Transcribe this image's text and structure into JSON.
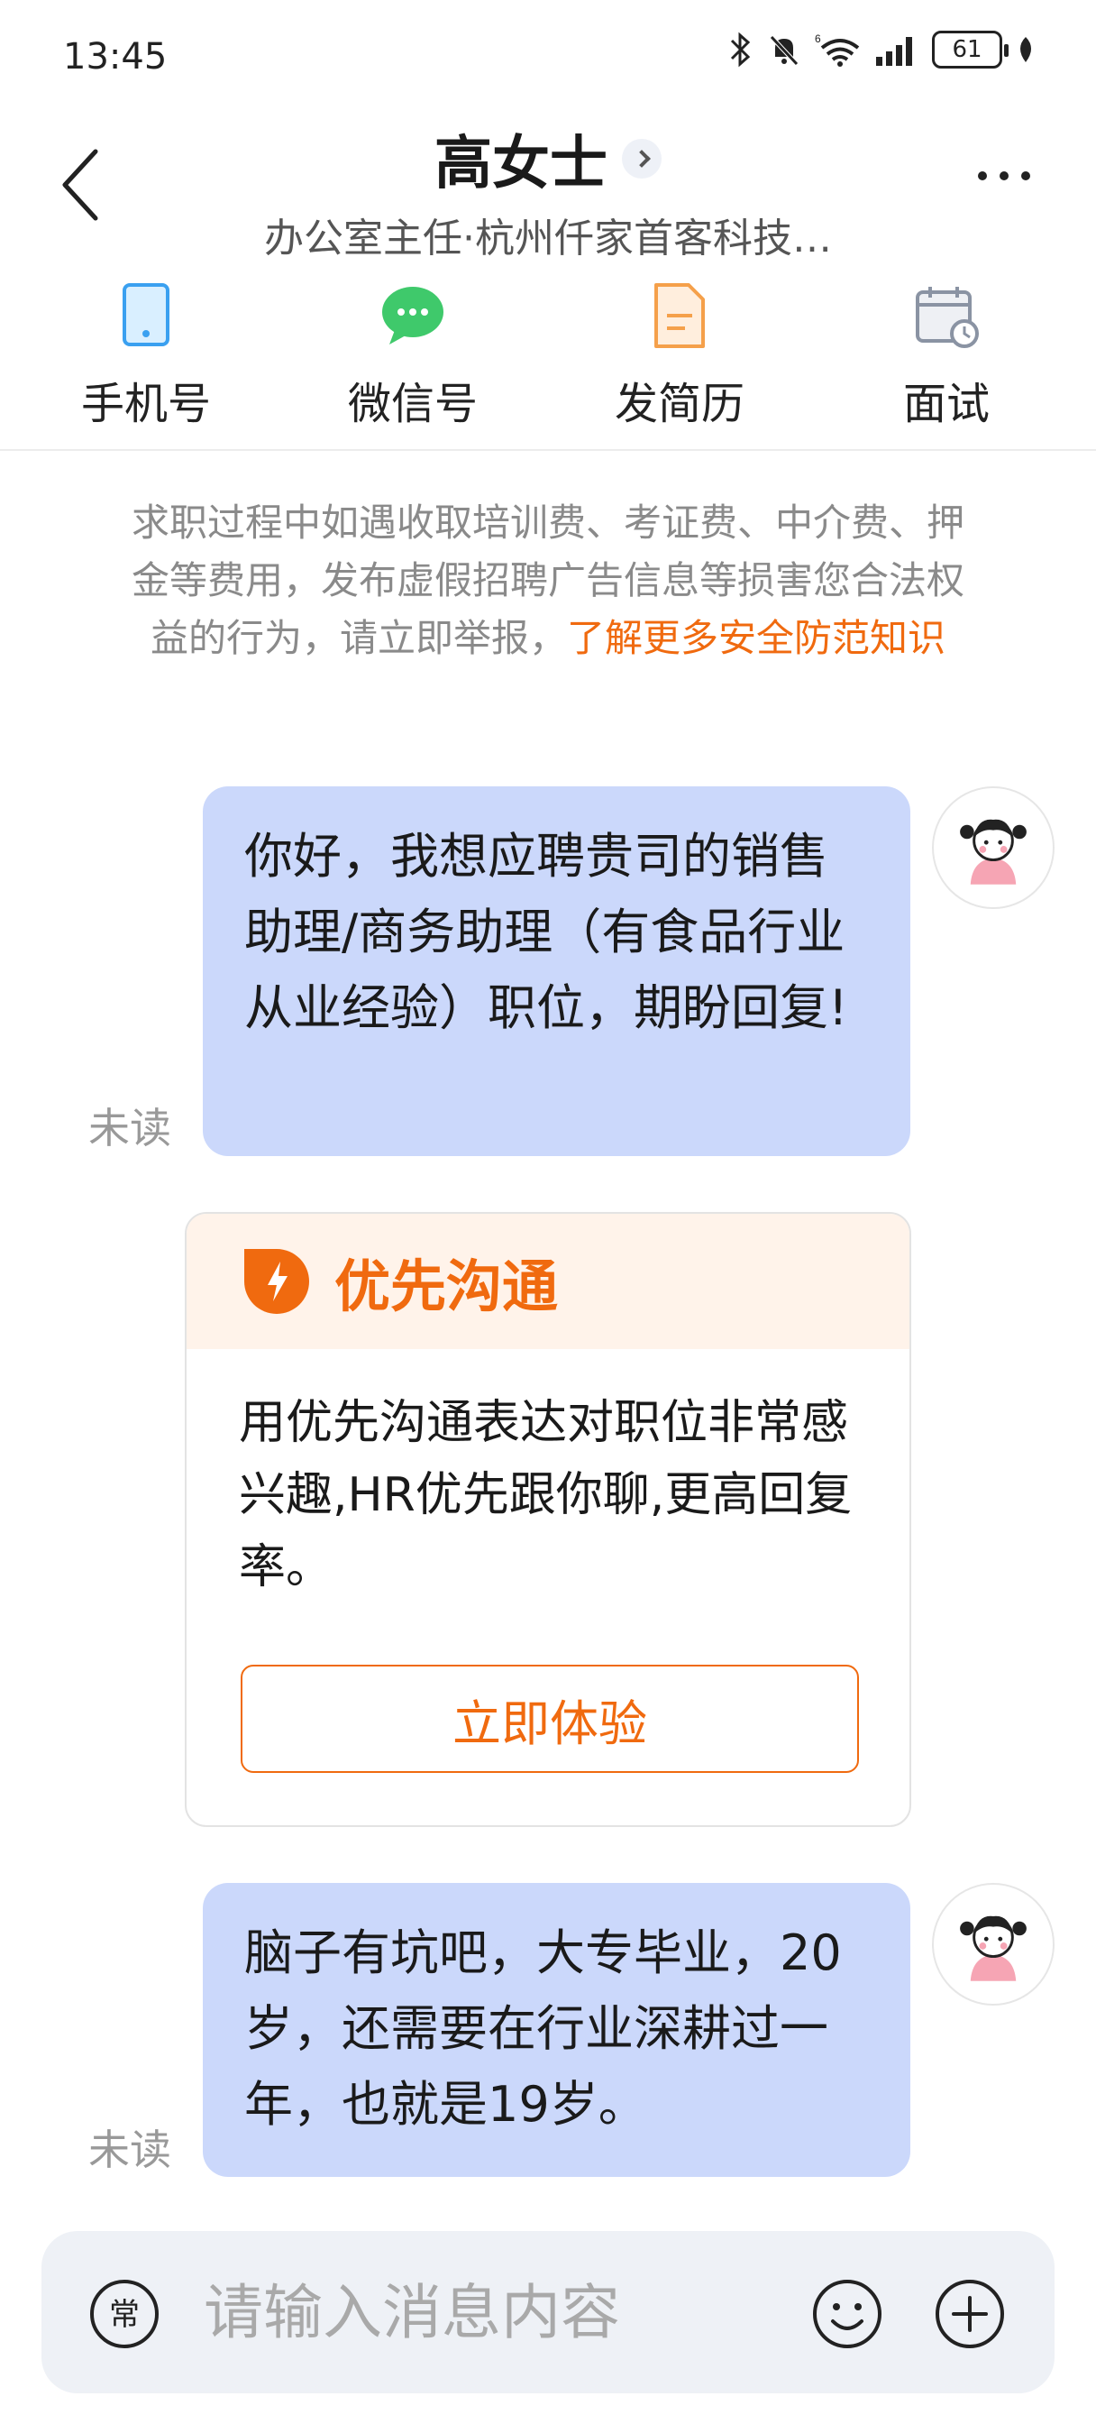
{
  "status_bar": {
    "time": "13:45",
    "battery": "61",
    "signal_label": "6"
  },
  "header": {
    "name": "高女士",
    "subtitle": "办公室主任·杭州仟家首客科技…"
  },
  "actions": [
    {
      "label": "手机号",
      "icon": "phone-icon"
    },
    {
      "label": "微信号",
      "icon": "wechat-icon"
    },
    {
      "label": "发简历",
      "icon": "resume-icon"
    },
    {
      "label": "面试",
      "icon": "interview-calendar-icon"
    }
  ],
  "notice": {
    "text": "求职过程中如遇收取培训费、考证费、中介费、押金等费用，发布虚假招聘广告信息等损害您合法权益的行为，请立即举报，",
    "link": "了解更多安全防范知识"
  },
  "messages": [
    {
      "text": "你好，我想应聘贵司的销售助理/商务助理（有食品行业从业经验）职位，期盼回复!",
      "status": "未读"
    },
    {
      "text": "脑子有坑吧，大专毕业，20岁，还需要在行业深耕过一年，也就是19岁。",
      "status": "未读"
    }
  ],
  "priority_card": {
    "title": "优先沟通",
    "body": "用优先沟通表达对职位非常感兴趣,HR优先跟你聊,更高回复率。",
    "button": "立即体验"
  },
  "input_bar": {
    "common_label": "常",
    "placeholder": "请输入消息内容"
  },
  "colors": {
    "accent": "#f06a0f",
    "bubble": "#cbd8fb",
    "wechat": "#3fc96b",
    "phone": "#3aa0f0"
  }
}
